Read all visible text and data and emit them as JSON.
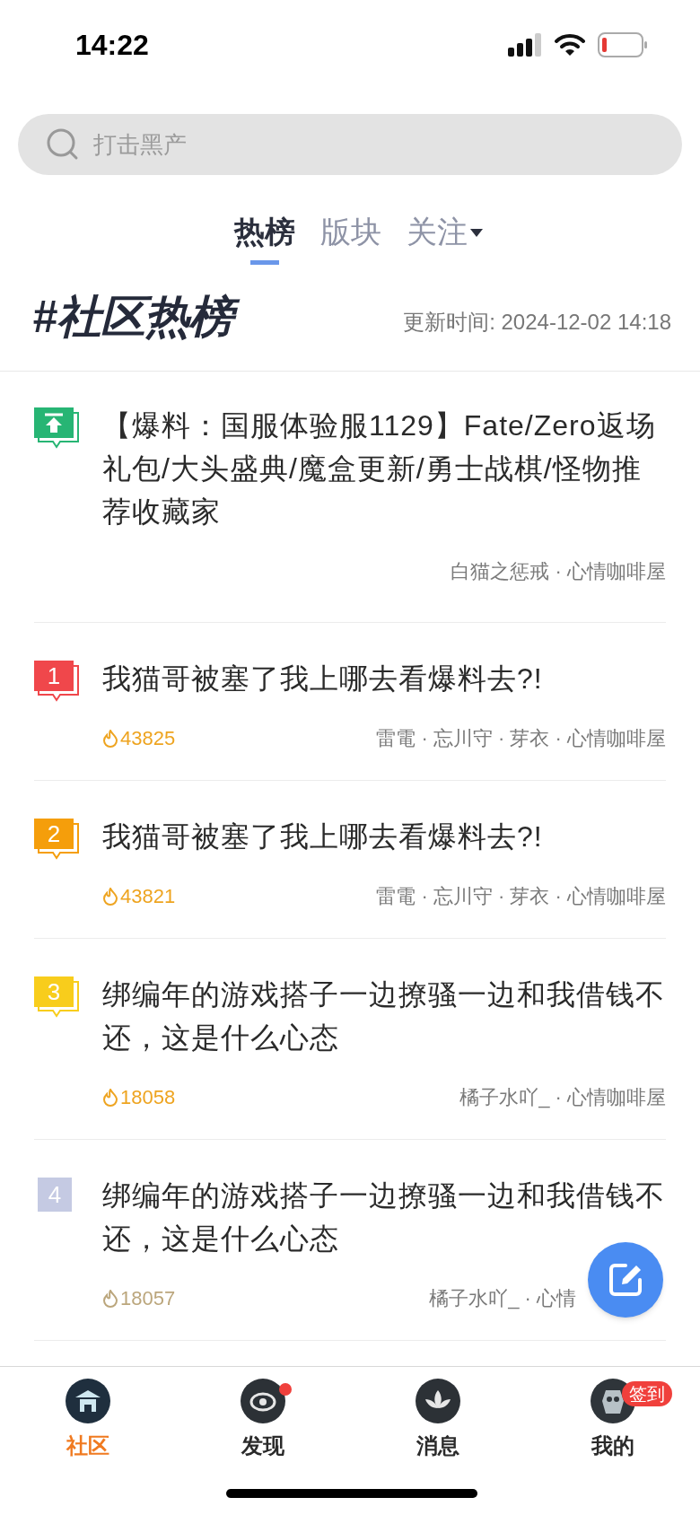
{
  "status_bar": {
    "time": "14:22"
  },
  "search": {
    "placeholder": "打击黑产"
  },
  "tabs": [
    {
      "label": "热榜",
      "selected": true,
      "dropdown": false
    },
    {
      "label": "版块",
      "selected": false,
      "dropdown": false
    },
    {
      "label": "关注",
      "selected": false,
      "dropdown": true
    }
  ],
  "heading": {
    "title": "#社区热榜",
    "updated": "更新时间: 2024-12-02 14:18"
  },
  "items": [
    {
      "kind": "pinned",
      "color": "#27b574",
      "title": "【爆料：国服体验服1129】Fate/Zero返场礼包/大头盛典/魔盒更新/勇士战棋/怪物推荐收藏家",
      "meta": "白猫之惩戒 · 心情咖啡屋"
    },
    {
      "kind": "rank",
      "rank": "1",
      "color": "#f0474b",
      "top": true,
      "heat": "43825",
      "title": "我猫哥被塞了我上哪去看爆料去?!",
      "meta": "雷電 · 忘川守 · 芽衣 · 心情咖啡屋"
    },
    {
      "kind": "rank",
      "rank": "2",
      "color": "#f59e0b",
      "top": true,
      "heat": "43821",
      "title": "我猫哥被塞了我上哪去看爆料去?!",
      "meta": "雷電 · 忘川守 · 芽衣 · 心情咖啡屋"
    },
    {
      "kind": "rank",
      "rank": "3",
      "color": "#f8cd1c",
      "top": true,
      "heat": "18058",
      "title": "绑编年的游戏搭子一边撩骚一边和我借钱不还，这是什么心态",
      "meta": "橘子水吖_ · 心情咖啡屋"
    },
    {
      "kind": "rank",
      "rank": "4",
      "color": "#c5cae3",
      "top": false,
      "heat": "18057",
      "title": "绑编年的游戏搭子一边撩骚一边和我借钱不还，这是什么心态",
      "meta": "橘子水吖_ · 心情"
    }
  ],
  "nav": [
    {
      "label": "社区",
      "selected": true,
      "dot": false
    },
    {
      "label": "发现",
      "selected": false,
      "dot": true
    },
    {
      "label": "消息",
      "selected": false,
      "dot": false
    },
    {
      "label": "我的",
      "selected": false,
      "dot": false,
      "badge": "签到"
    }
  ]
}
